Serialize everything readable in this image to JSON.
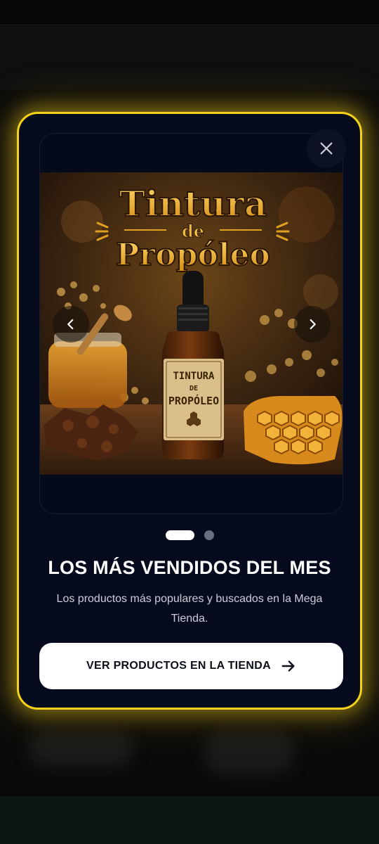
{
  "modal": {
    "close_icon": "close-icon",
    "accent_color": "#f5d21a",
    "slide": {
      "image_title_line1": "Tintura",
      "image_title_line2": "de",
      "image_title_line3": "Propóleo",
      "label_line1": "TINTURA",
      "label_line2": "DE",
      "label_line3": "PROPÓLEO"
    },
    "prev_icon": "chevron-left-icon",
    "next_icon": "chevron-right-icon",
    "pagination": {
      "active_index": 0,
      "count": 2
    },
    "title": "LOS MÁS VENDIDOS DEL MES",
    "subtitle": "Los productos más populares y buscados en la Mega Tienda.",
    "cta_label": "VER PRODUCTOS EN LA TIENDA",
    "cta_icon": "arrow-right-icon"
  }
}
